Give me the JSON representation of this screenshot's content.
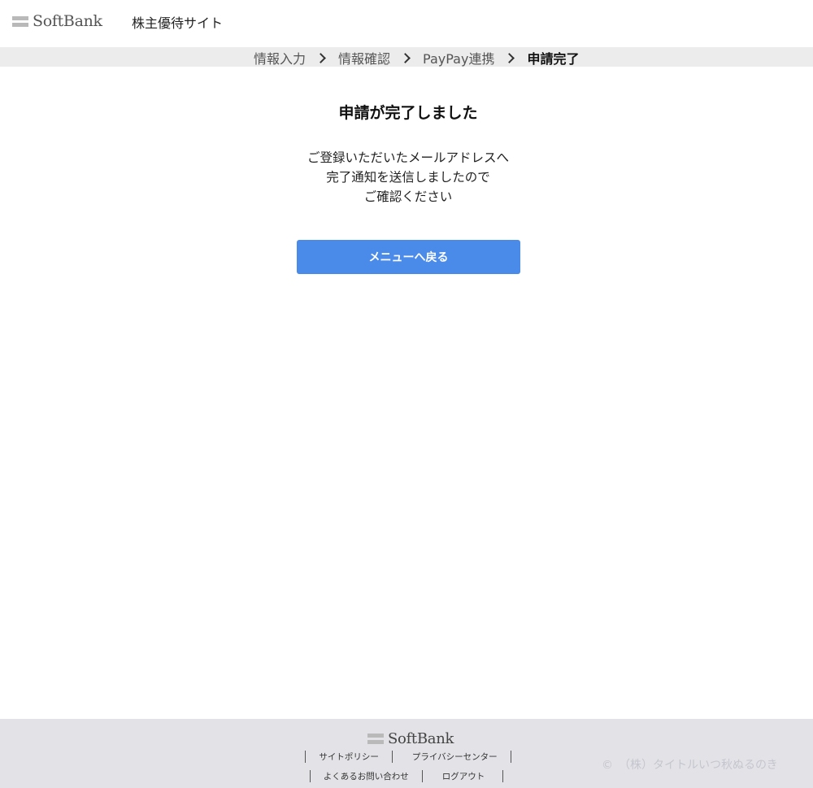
{
  "header": {
    "brand": "SoftBank",
    "site_title": "株主優待サイト"
  },
  "steps": [
    {
      "label": "情報入力"
    },
    {
      "label": "情報確認"
    },
    {
      "label": "PayPay連携"
    },
    {
      "label": "申請完了"
    }
  ],
  "main": {
    "title": "申請が完了しました",
    "message_lines": [
      "ご登録いただいたメールアドレスへ",
      "完了通知を送信しましたので",
      "ご確認ください"
    ],
    "button_label": "メニューへ戻る"
  },
  "footer": {
    "brand": "SoftBank",
    "links_row1": [
      "サイトポリシー",
      "プライバシーセンター"
    ],
    "links_row2": [
      "よくあるお問い合わせ",
      "ログアウト"
    ],
    "copyright": "©　（株）タイトルいつ秋ぬるのき"
  },
  "colors": {
    "primary_button": "#4a8ae9",
    "steps_bar": "#ececec",
    "footer_bg": "#e3e3e7"
  }
}
